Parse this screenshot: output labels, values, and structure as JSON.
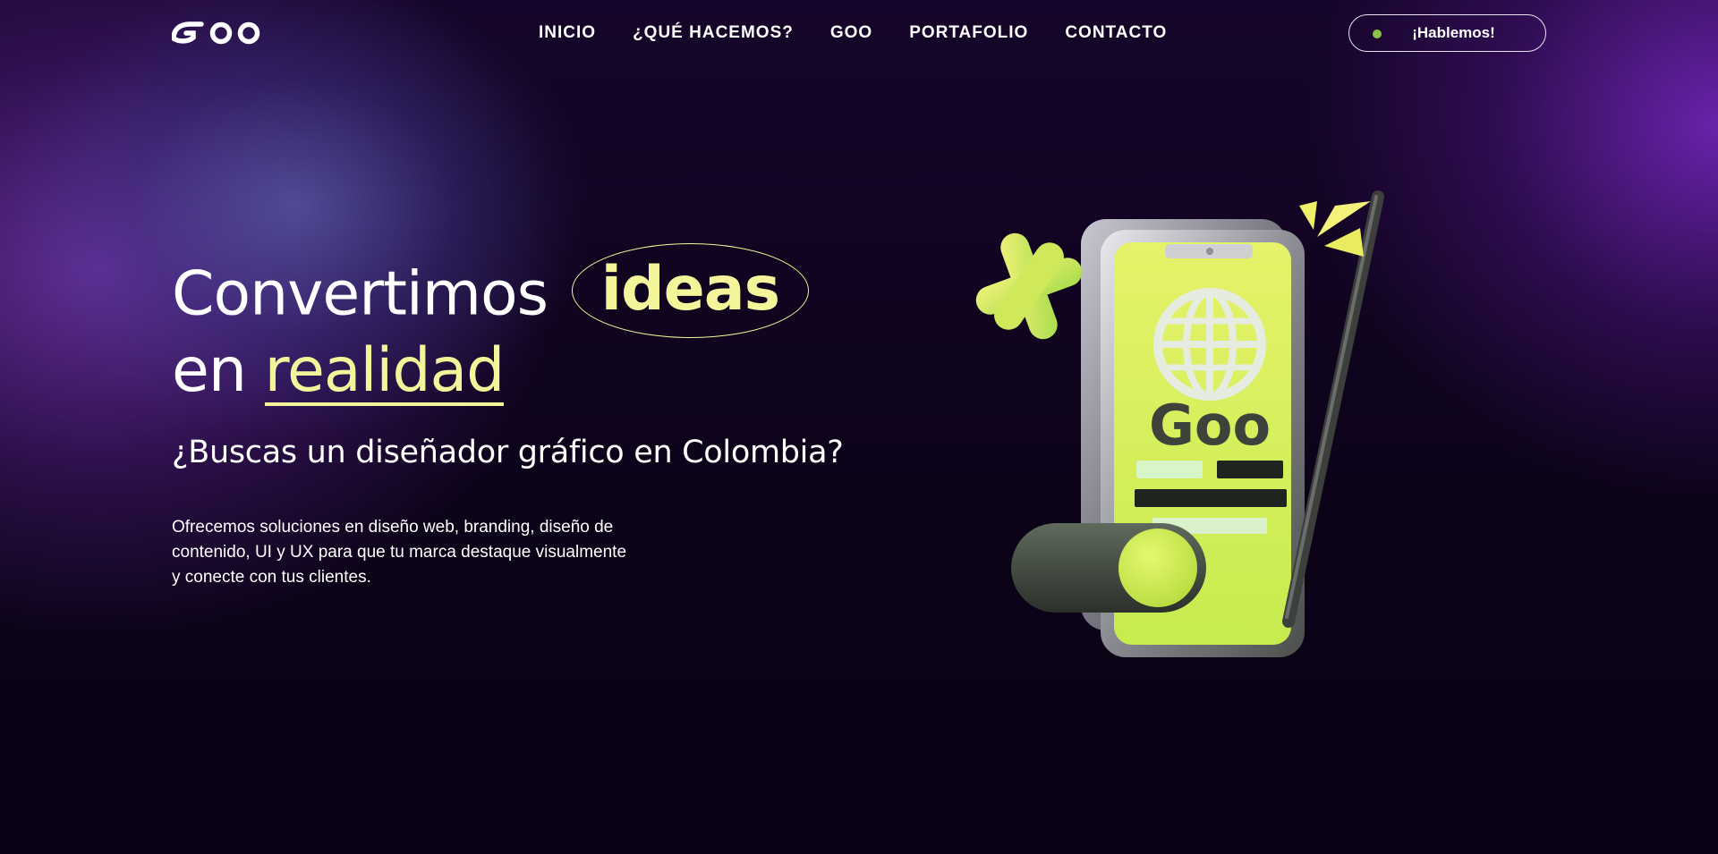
{
  "brand": {
    "logo_text": "Goo",
    "icon": "goo-logo"
  },
  "nav": {
    "items": [
      {
        "label": "INICIO"
      },
      {
        "label": "¿QUÉ HACEMOS?"
      },
      {
        "label": "GOO"
      },
      {
        "label": "PORTAFOLIO"
      },
      {
        "label": "CONTACTO"
      }
    ]
  },
  "cta": {
    "label": "¡Hablemos!",
    "status_icon": "green-dot-icon"
  },
  "hero": {
    "title_part1": "Convertimos",
    "title_highlight": "ideas",
    "title_part2": "en",
    "title_underlined": "realidad",
    "subheading": "¿Buscas un diseñador gráfico en Colombia?",
    "description": "Ofrecemos soluciones en diseño web, branding, diseño de contenido, UI y UX para que tu marca destaque visualmente y conecte con tus clientes."
  },
  "illustration": {
    "icon": "phone-3d-illustration",
    "screen_text": "Goo"
  },
  "colors": {
    "accent_yellow": "#f4f59a",
    "screen_green": "#d2ef55",
    "status_dot": "#8bc34a",
    "bg_dark": "#0b0216",
    "bg_purple": "#6e24b2"
  }
}
